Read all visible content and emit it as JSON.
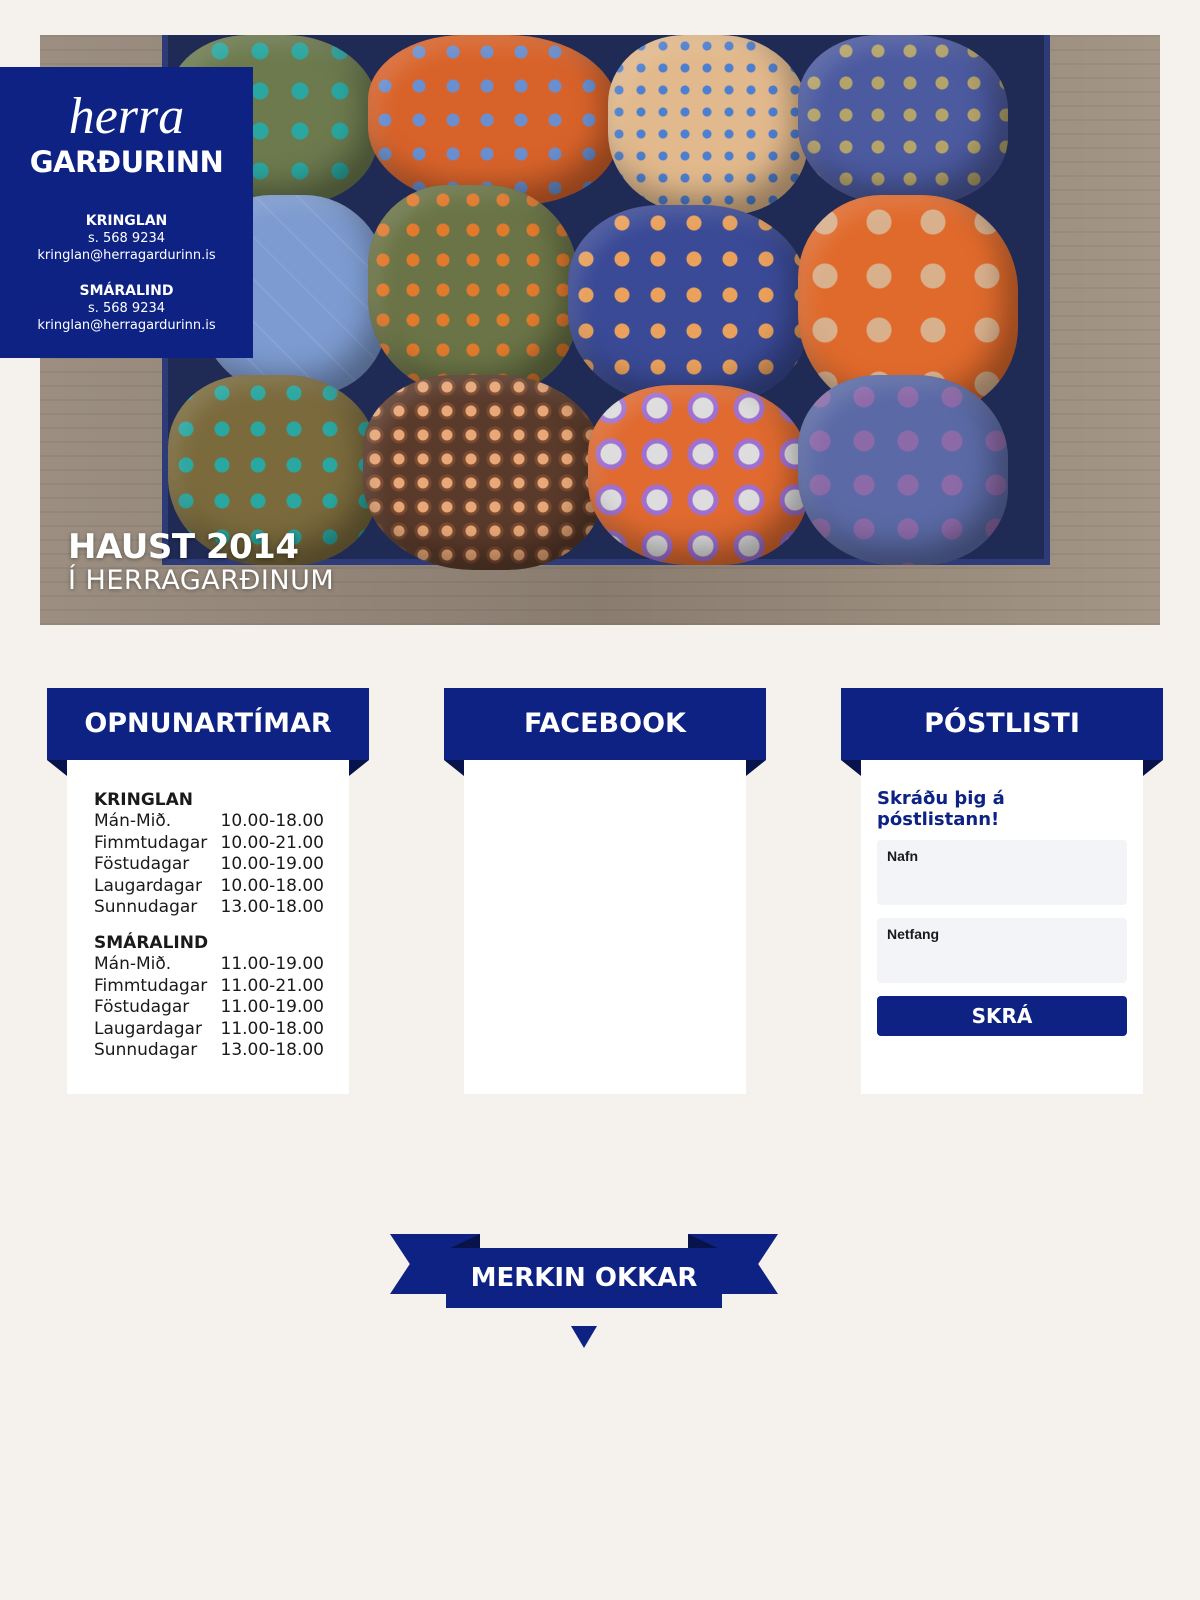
{
  "brand": {
    "script": "herra",
    "wordmark": "GARÐURINN",
    "stores": [
      {
        "name": "KRINGLAN",
        "phone": "s. 568 9234",
        "email": "kringlan@herragardurinn.is"
      },
      {
        "name": "SMÁRALIND",
        "phone": "s. 568 9234",
        "email": "kringlan@herragardurinn.is"
      }
    ]
  },
  "hero": {
    "title": "HAUST 2014",
    "subtitle": "Í HERRAGARÐINUM"
  },
  "opening_hours": {
    "heading": "OPNUNARTÍMAR",
    "locations": [
      {
        "name": "KRINGLAN",
        "rows": [
          {
            "day": "Mán-Mið.",
            "time": "10.00-18.00"
          },
          {
            "day": "Fimmtudagar",
            "time": "10.00-21.00"
          },
          {
            "day": "Föstudagar",
            "time": "10.00-19.00"
          },
          {
            "day": "Laugardagar",
            "time": "10.00-18.00"
          },
          {
            "day": "Sunnudagar",
            "time": "13.00-18.00"
          }
        ]
      },
      {
        "name": "SMÁRALIND",
        "rows": [
          {
            "day": "Mán-Mið.",
            "time": "11.00-19.00"
          },
          {
            "day": "Fimmtudagar",
            "time": "11.00-21.00"
          },
          {
            "day": "Föstudagar",
            "time": "11.00-19.00"
          },
          {
            "day": "Laugardagar",
            "time": "11.00-18.00"
          },
          {
            "day": "Sunnudagar",
            "time": "13.00-18.00"
          }
        ]
      }
    ]
  },
  "facebook": {
    "heading": "FACEBOOK"
  },
  "newsletter": {
    "heading": "PÓSTLISTI",
    "prompt": "Skráðu þig á póstlistann!",
    "name_label": "Nafn",
    "name_value": "",
    "email_label": "Netfang",
    "email_value": "",
    "submit_label": "SKRÁ"
  },
  "brands_section": {
    "heading": "MERKIN OKKAR"
  },
  "colors": {
    "brand_blue": "#0d2283",
    "page_bg": "#f5f1ec",
    "field_bg": "#f3f4f8"
  }
}
